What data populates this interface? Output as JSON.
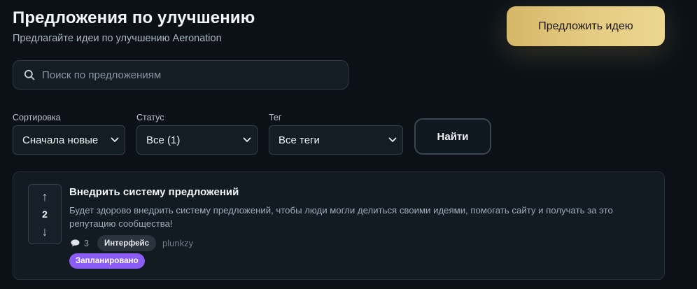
{
  "header": {
    "title": "Предложения по улучшению",
    "subtitle": "Предлагайте идеи по улучшению Aeronation",
    "propose_label": "Предложить идею"
  },
  "search": {
    "placeholder": "Поиск по предложениям",
    "value": ""
  },
  "filters": {
    "sort": {
      "label": "Сортировка",
      "value": "Сначала новые"
    },
    "status": {
      "label": "Статус",
      "value": "Все (1)"
    },
    "tag": {
      "label": "Тег",
      "value": "Все теги"
    },
    "find_label": "Найти"
  },
  "suggestions": [
    {
      "votes": "2",
      "up_icon": "↑",
      "down_icon": "↓",
      "title": "Внедрить систему предложений",
      "description": "Будет здорово внедрить систему предложений, чтобы люди могли делиться своими идеями, помогать сайту и получать за это репутацию сообщества!",
      "comments": "3",
      "tag": "Интерфейс",
      "author": "plunkzy",
      "status": "Запланировано"
    }
  ],
  "colors": {
    "background": "#0b1117",
    "accent_gold": "#e5cc84",
    "status_purple": "#8b5cf6",
    "card": "#121a22"
  },
  "icons": {
    "search": "search-icon",
    "comment": "comment-icon",
    "dropdown": "chevron-down-icon"
  }
}
